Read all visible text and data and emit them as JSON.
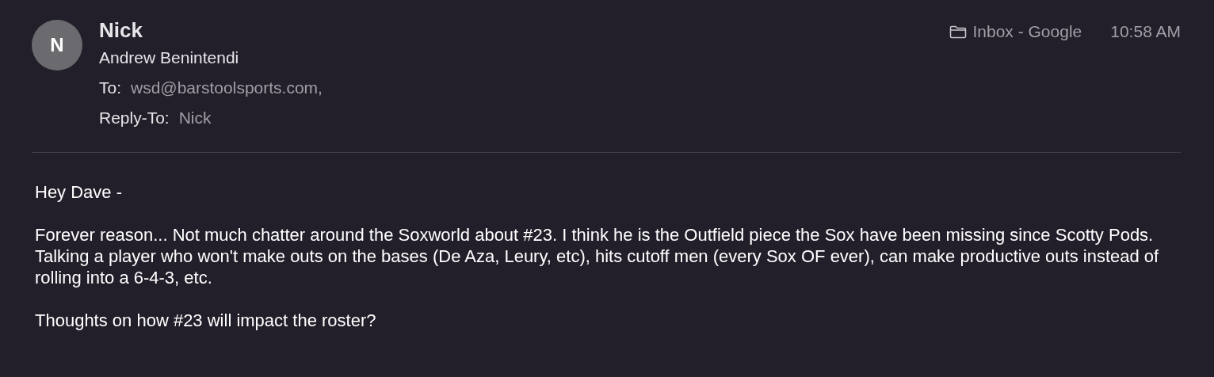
{
  "header": {
    "avatar": "N",
    "sender": "Nick",
    "subject": "Andrew Benintendi",
    "to_label": "To:",
    "to": "wsd@barstoolsports.com,",
    "reply_to_label": "Reply-To:",
    "reply_to": "Nick",
    "mailbox": "Inbox - Google",
    "time": "10:58 AM"
  },
  "body": [
    "Hey Dave -",
    "Forever reason... Not much chatter around the Soxworld about #23.  I think he is the Outfield piece the Sox have been missing since Scotty Pods.  Talking a player who won't make outs on the bases (De Aza, Leury, etc), hits cutoff men (every Sox OF ever), can make productive outs instead of rolling into a 6-4-3, etc.",
    "Thoughts on how #23 will impact the roster?"
  ]
}
